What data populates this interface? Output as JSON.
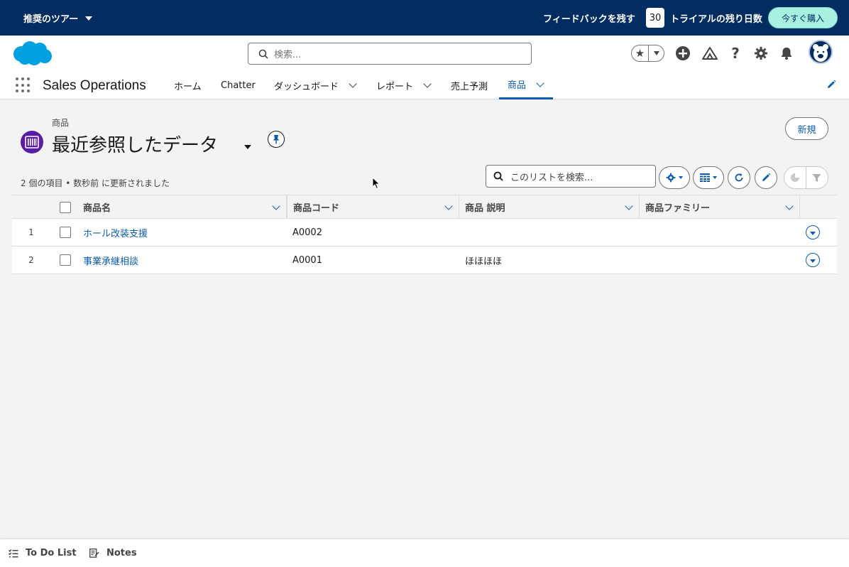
{
  "trial_banner": {
    "tour_label": "推奨のツアー",
    "feedback_label": "フィードバックを残す",
    "days_remaining": "30",
    "days_label": "トライアルの残り日数",
    "buy_label": "今すぐ購入"
  },
  "global_header": {
    "search_placeholder": "検索..."
  },
  "nav": {
    "app_name": "Sales Operations",
    "items": [
      {
        "label": "ホーム",
        "has_menu": false,
        "active": false
      },
      {
        "label": "Chatter",
        "has_menu": false,
        "active": false
      },
      {
        "label": "ダッシュボード",
        "has_menu": true,
        "active": false
      },
      {
        "label": "レポート",
        "has_menu": true,
        "active": false
      },
      {
        "label": "売上予測",
        "has_menu": false,
        "active": false
      },
      {
        "label": "商品",
        "has_menu": true,
        "active": true
      }
    ]
  },
  "page": {
    "object_label": "商品",
    "list_view_title": "最近参照したデータ",
    "new_button": "新規",
    "meta_text": "2 個の項目 • 数秒前 に更新されました",
    "list_search_placeholder": "このリストを検索..."
  },
  "table": {
    "columns": [
      "商品名",
      "商品コード",
      "商品 説明",
      "商品ファミリー"
    ],
    "rows": [
      {
        "num": "1",
        "name": "ホール改装支援",
        "code": "A0002",
        "description": "",
        "family": ""
      },
      {
        "num": "2",
        "name": "事業承継相談",
        "code": "A0001",
        "description": "ほほほほ",
        "family": ""
      }
    ]
  },
  "utility_bar": {
    "todo_label": "To Do List",
    "notes_label": "Notes"
  },
  "colors": {
    "brand_navy": "#032d60",
    "link_blue": "#0b5cab",
    "buy_button": "#a8f0e0",
    "product_icon": "#5a1ba9"
  }
}
